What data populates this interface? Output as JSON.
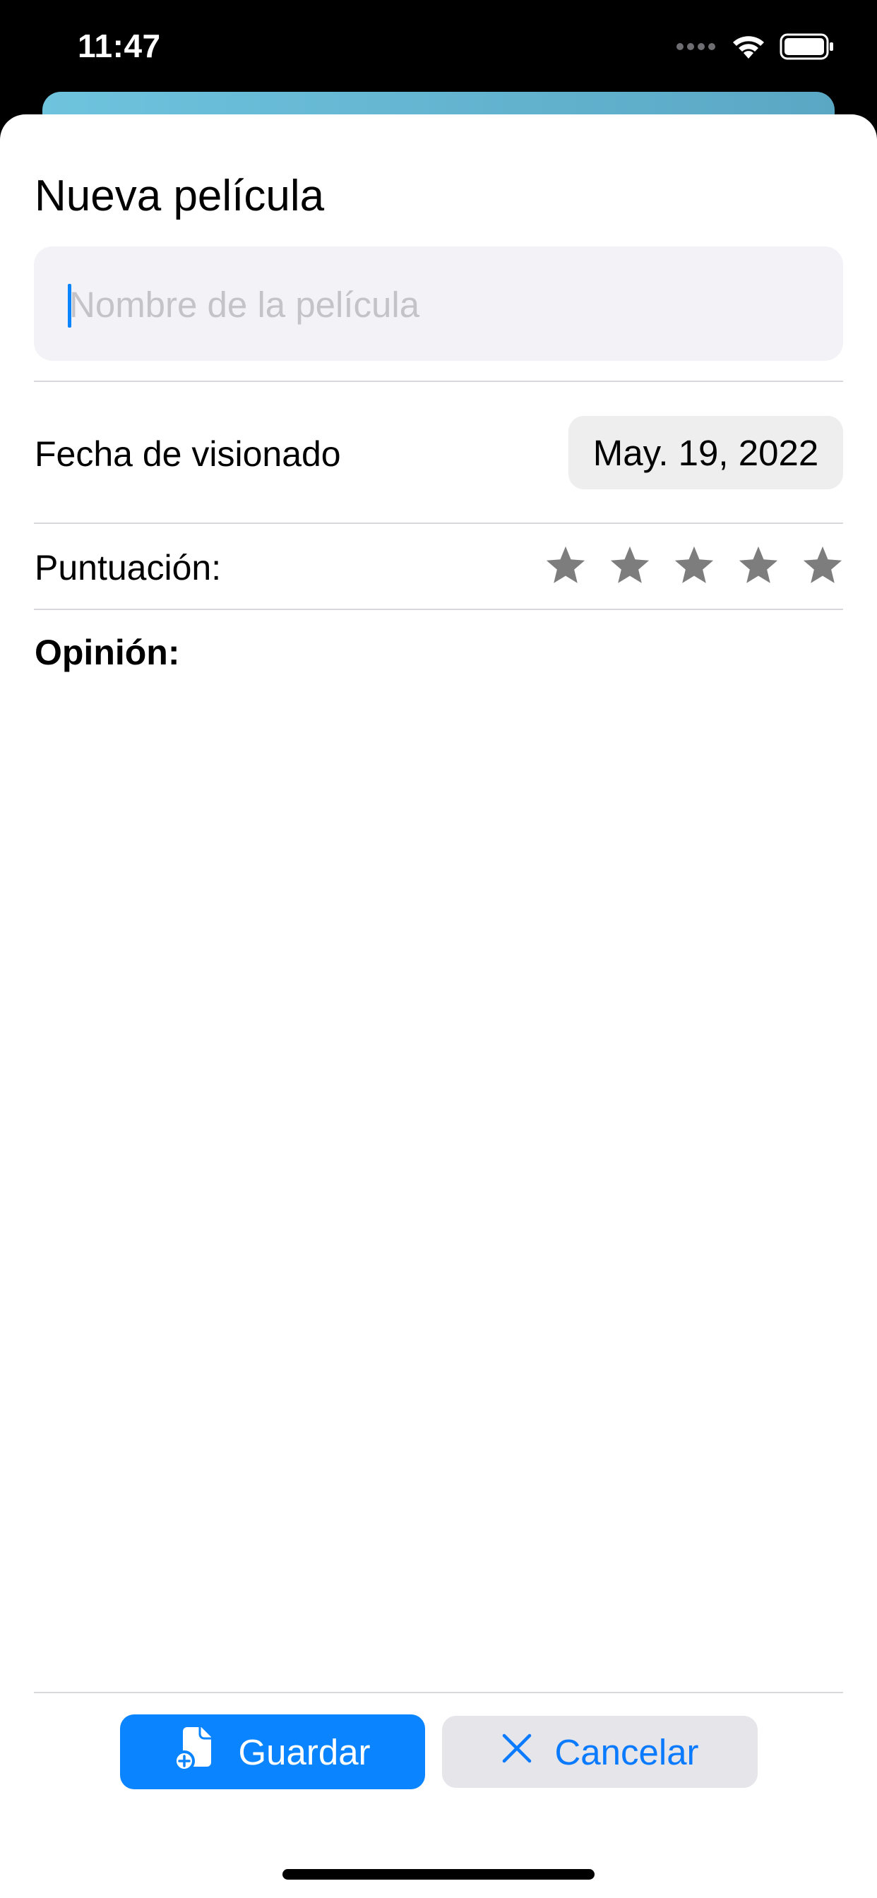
{
  "status_bar": {
    "time": "11:47",
    "icons": [
      "signal-dots-icon",
      "wifi-icon",
      "battery-icon"
    ]
  },
  "form": {
    "title": "Nueva película",
    "name_field": {
      "value": "",
      "placeholder": "Nombre de la película"
    },
    "watch_date": {
      "label": "Fecha de visionado",
      "value": "May. 19, 2022"
    },
    "rating": {
      "label": "Puntuación:",
      "max": 5,
      "value": 0
    },
    "opinion": {
      "label": "Opinión:",
      "value": ""
    }
  },
  "actions": {
    "save_label": "Guardar",
    "cancel_label": "Cancelar"
  },
  "colors": {
    "accent": "#0a84ff",
    "star": "#7d7d7d",
    "header_card": "#64b4d0"
  }
}
